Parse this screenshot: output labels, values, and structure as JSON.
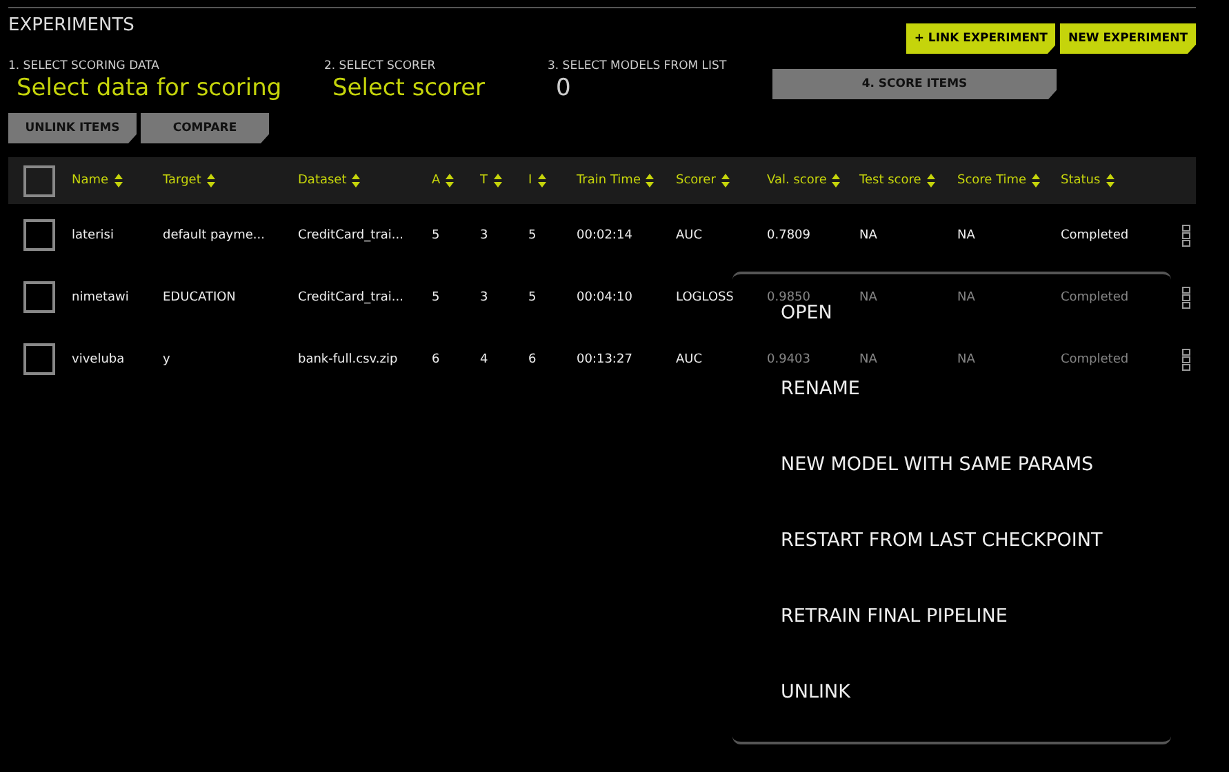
{
  "title": "EXPERIMENTS",
  "top_buttons": [
    "+ LINK EXPERIMENT",
    "NEW EXPERIMENT"
  ],
  "steps": [
    {
      "label": "1. SELECT SCORING DATA",
      "value": "Select data for scoring",
      "kind": "select"
    },
    {
      "label": "2. SELECT SCORER",
      "value": "Select scorer",
      "kind": "select"
    },
    {
      "label": "3. SELECT MODELS FROM LIST",
      "value": "0",
      "kind": "count"
    }
  ],
  "score_button": "4. SCORE ITEMS",
  "action_buttons": [
    "UNLINK ITEMS",
    "COMPARE"
  ],
  "table": {
    "select_all_checked": false,
    "columns": [
      "Name",
      "Target",
      "Dataset",
      "A",
      "T",
      "I",
      "Train Time",
      "Scorer",
      "Val. score",
      "Test score",
      "Score Time",
      "Status"
    ],
    "rows": [
      {
        "checked": false,
        "cells": [
          "laterisi",
          "default payme...",
          "CreditCard_trai...",
          "5",
          "3",
          "5",
          "00:02:14",
          "AUC",
          "0.7809",
          "NA",
          "NA",
          "Completed"
        ]
      },
      {
        "checked": false,
        "cells": [
          "nimetawi",
          "EDUCATION",
          "CreditCard_trai...",
          "5",
          "3",
          "5",
          "00:04:10",
          "LOGLOSS",
          "0.9850",
          "NA",
          "NA",
          "Completed"
        ]
      },
      {
        "checked": false,
        "cells": [
          "viveluba",
          "y",
          "bank-full.csv.zip",
          "6",
          "4",
          "6",
          "00:13:27",
          "AUC",
          "0.9403",
          "NA",
          "NA",
          "Completed"
        ]
      }
    ]
  },
  "context_menu": [
    "OPEN",
    "RENAME",
    "NEW MODEL WITH SAME PARAMS",
    "RESTART FROM LAST CHECKPOINT",
    "RETRAIN FINAL PIPELINE",
    "UNLINK"
  ]
}
